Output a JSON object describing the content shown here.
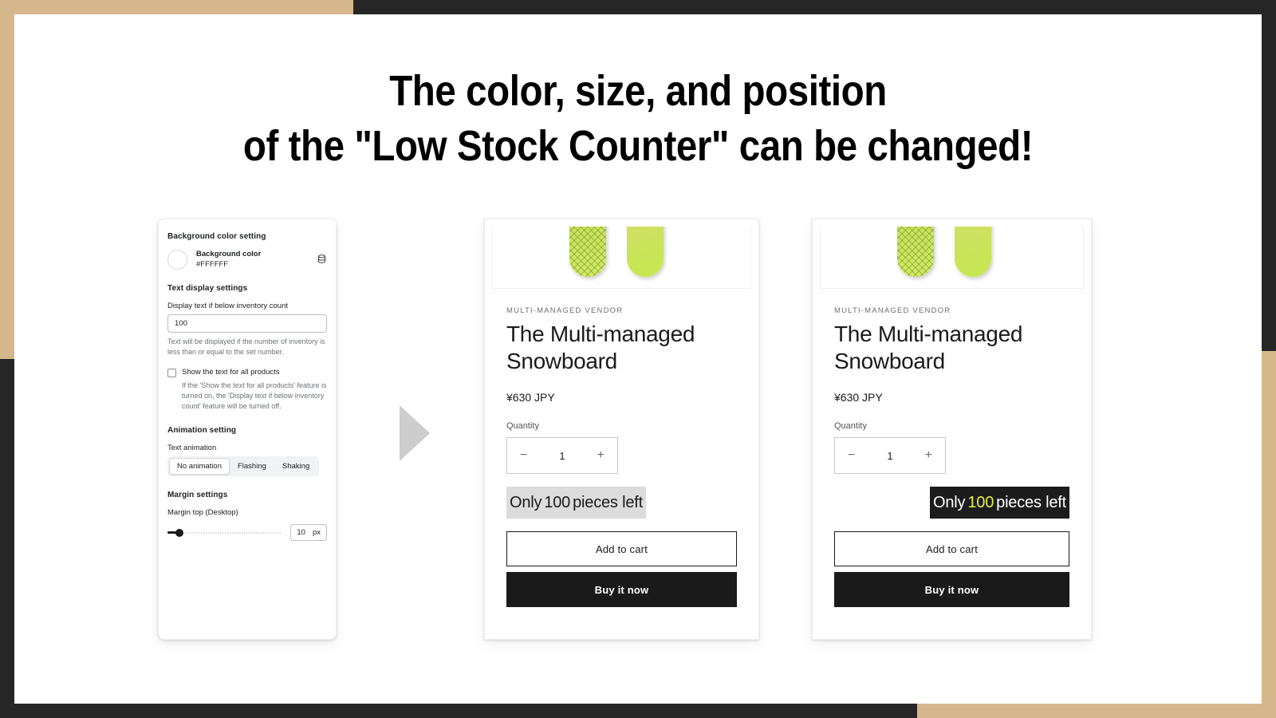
{
  "frame": {
    "tan_color": "#d6b78c",
    "dark_color": "#262626"
  },
  "headline": {
    "line1": "The color, size, and position",
    "line2": "of the \"Low Stock Counter\" can be changed!"
  },
  "settings_panel": {
    "background_section": {
      "heading": "Background color setting",
      "color_name": "Background color",
      "color_hex": "#FFFFFF",
      "swatch_value": "#FFFFFF",
      "stack_icon": "database-icon"
    },
    "text_display_section": {
      "heading": "Text display settings",
      "inventory_label": "Display text if below inventory count",
      "inventory_value": "100",
      "inventory_help": "Text will be displayed if the number of inventory is less than or equal to the set number.",
      "checkbox_label": "Show the text for all products",
      "checkbox_checked": false,
      "checkbox_help": "If the 'Show the text for all products' feature is turned on, the 'Display text if below inventory count' feature will be turned off."
    },
    "animation_section": {
      "heading": "Animation setting",
      "field_label": "Text animation",
      "options": [
        "No animation",
        "Flashing",
        "Shaking"
      ],
      "selected": "No animation"
    },
    "margin_section": {
      "heading": "Margin settings",
      "field_label": "Margin top (Desktop)",
      "value": "10",
      "unit": "px"
    }
  },
  "arrow": {
    "name": "flow-arrow",
    "color": "#cdcdcd"
  },
  "cards": {
    "before": {
      "vendor": "MULTI-MANAGED VENDOR",
      "title": "The Multi-managed Snowboard",
      "price": "¥630 JPY",
      "quantity_label": "Quantity",
      "quantity_value": "1",
      "decrease_label": "−",
      "increase_label": "+",
      "stock_prefix": "Only ",
      "stock_count": "100",
      "stock_suffix": " pieces left",
      "stock_bg": "#dcdcdc",
      "stock_text_color": "#1a1a1a",
      "stock_count_color": "#1a1a1a",
      "stock_align": "left",
      "add_to_cart": "Add to cart",
      "buy_now": "Buy it now"
    },
    "after": {
      "vendor": "MULTI-MANAGED VENDOR",
      "title": "The Multi-managed Snowboard",
      "price": "¥630 JPY",
      "quantity_label": "Quantity",
      "quantity_value": "1",
      "decrease_label": "−",
      "increase_label": "+",
      "stock_prefix": "Only ",
      "stock_count": "100",
      "stock_suffix": " pieces left",
      "stock_bg": "#1c1c1c",
      "stock_text_color": "#ffffff",
      "stock_count_color": "#e8ee3c",
      "stock_align": "right",
      "add_to_cart": "Add to cart",
      "buy_now": "Buy it now"
    }
  }
}
